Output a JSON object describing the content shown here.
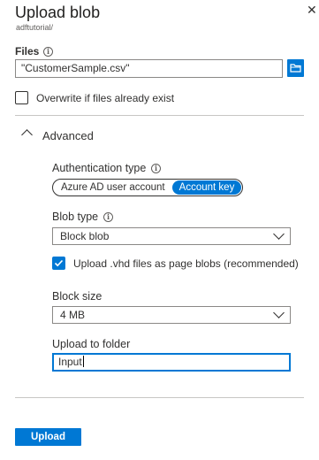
{
  "panel": {
    "title": "Upload blob",
    "subtitle": "adftutorial/"
  },
  "files": {
    "label": "Files",
    "value": "\"CustomerSample.csv\"",
    "folder_icon": "folder-icon"
  },
  "overwrite": {
    "label": "Overwrite if files already exist",
    "checked": false
  },
  "advanced": {
    "label": "Advanced",
    "expanded": true
  },
  "auth": {
    "label": "Authentication type",
    "options": [
      "Azure AD user account",
      "Account key"
    ],
    "selected": "Account key"
  },
  "blob_type": {
    "label": "Blob type",
    "value": "Block blob"
  },
  "vhd": {
    "label": "Upload .vhd files as page blobs (recommended)",
    "checked": true
  },
  "block_size": {
    "label": "Block size",
    "value": "4 MB"
  },
  "folder": {
    "label": "Upload to folder",
    "value": "Input"
  },
  "actions": {
    "upload_label": "Upload"
  },
  "colors": {
    "accent": "#0078d4",
    "text": "#323130",
    "border": "#8a8886"
  }
}
